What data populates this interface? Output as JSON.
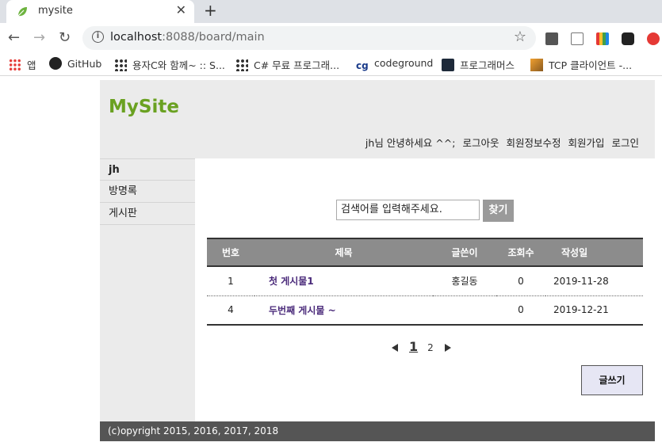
{
  "browser": {
    "tab_title": "mysite",
    "close": "✕",
    "new_tab": "+",
    "url_host": "localhost",
    "url_rest": ":8088/board/main",
    "star": "☆",
    "nav": {
      "back": "←",
      "forward": "→",
      "reload": "↻"
    },
    "bookmarks": [
      {
        "label": "앱",
        "icon": "apps-grid-icon"
      },
      {
        "label": "GitHub",
        "icon": "github-icon"
      },
      {
        "label": "용자C와 함께~ :: S...",
        "icon": "tistory-icon"
      },
      {
        "label": "C# 무료 프로그래...",
        "icon": "tistory-icon"
      },
      {
        "label": "codeground",
        "icon": "codeground-icon"
      },
      {
        "label": "프로그래머스",
        "icon": "programmers-icon"
      },
      {
        "label": "TCP 클라이언트 -...",
        "icon": "bookmark-image-icon"
      }
    ]
  },
  "site": {
    "logo": "MySite",
    "nav": [
      "jh님 안녕하세요 ^^;",
      "로그아웃",
      "회원정보수정",
      "회원가입",
      "로그인"
    ],
    "sidebar": [
      "jh",
      "방명록",
      "게시판"
    ],
    "search": {
      "placeholder": "검색어를 입력해주세요.",
      "button": "찾기"
    },
    "table": {
      "headers": [
        "번호",
        "제목",
        "글쓴이",
        "조회수",
        "작성일"
      ],
      "rows": [
        {
          "no": "1",
          "title": "첫 게시물1",
          "author": "홍길동",
          "views": "0",
          "date": "2019-11-28"
        },
        {
          "no": "4",
          "title": "두번째 게시물 ~",
          "author": "",
          "views": "0",
          "date": "2019-12-21"
        }
      ]
    },
    "pager": {
      "current": "1",
      "next": "2"
    },
    "write_button": "글쓰기",
    "footer": "(c)opyright 2015, 2016, 2017, 2018"
  },
  "colors": {
    "logo": "#6aa121",
    "header_bg": "#ebebeb",
    "table_head": "#8c8c8c",
    "footer": "#555555"
  }
}
